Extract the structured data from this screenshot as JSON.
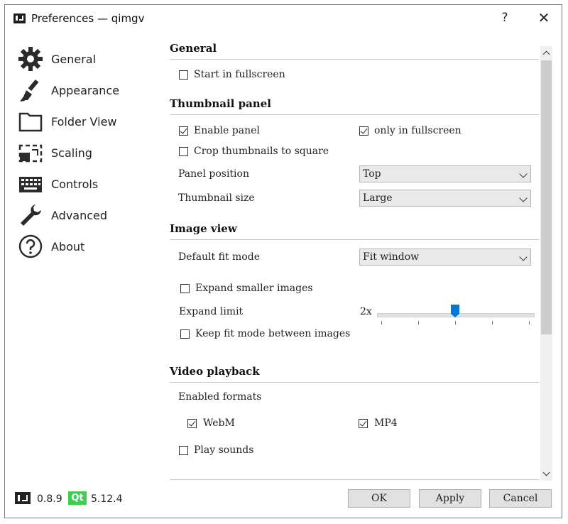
{
  "window": {
    "title": "Preferences — qimgv",
    "help_glyph": "?",
    "close_glyph": "✕"
  },
  "sidebar": {
    "items": [
      {
        "label": "General",
        "icon": "gear-icon"
      },
      {
        "label": "Appearance",
        "icon": "brush-icon"
      },
      {
        "label": "Folder View",
        "icon": "folder-icon"
      },
      {
        "label": "Scaling",
        "icon": "scaling-icon"
      },
      {
        "label": "Controls",
        "icon": "keyboard-icon"
      },
      {
        "label": "Advanced",
        "icon": "wrench-icon"
      },
      {
        "label": "About",
        "icon": "question-icon"
      }
    ]
  },
  "general": {
    "title": "General",
    "start_fullscreen": {
      "label": "Start in fullscreen",
      "checked": false
    }
  },
  "thumbnail": {
    "title": "Thumbnail panel",
    "enable_panel": {
      "label": "Enable panel",
      "checked": true
    },
    "only_fullscreen": {
      "label": "only in fullscreen",
      "checked": true
    },
    "crop_square": {
      "label": "Crop thumbnails to square",
      "checked": false
    },
    "panel_position": {
      "label": "Panel position",
      "value": "Top"
    },
    "thumbnail_size": {
      "label": "Thumbnail size",
      "value": "Large"
    }
  },
  "image_view": {
    "title": "Image view",
    "fit_mode": {
      "label": "Default fit mode",
      "value": "Fit window"
    },
    "expand_smaller": {
      "label": "Expand smaller images",
      "checked": false
    },
    "expand_limit": {
      "label": "Expand limit",
      "value": "2x",
      "slider_fraction": 0.5
    },
    "keep_fit": {
      "label": "Keep fit mode between images",
      "checked": false
    }
  },
  "video": {
    "title": "Video playback",
    "enabled_formats": "Enabled formats",
    "webm": {
      "label": "WebM",
      "checked": true
    },
    "mp4": {
      "label": "MP4",
      "checked": true
    },
    "play_sounds": {
      "label": "Play sounds",
      "checked": false
    }
  },
  "footer": {
    "app_version": "0.8.9",
    "qt_label": "Qt",
    "qt_version": "5.12.4",
    "ok": "OK",
    "apply": "Apply",
    "cancel": "Cancel"
  },
  "colors": {
    "accent": "#0078d7",
    "qt_green": "#41cd52"
  }
}
